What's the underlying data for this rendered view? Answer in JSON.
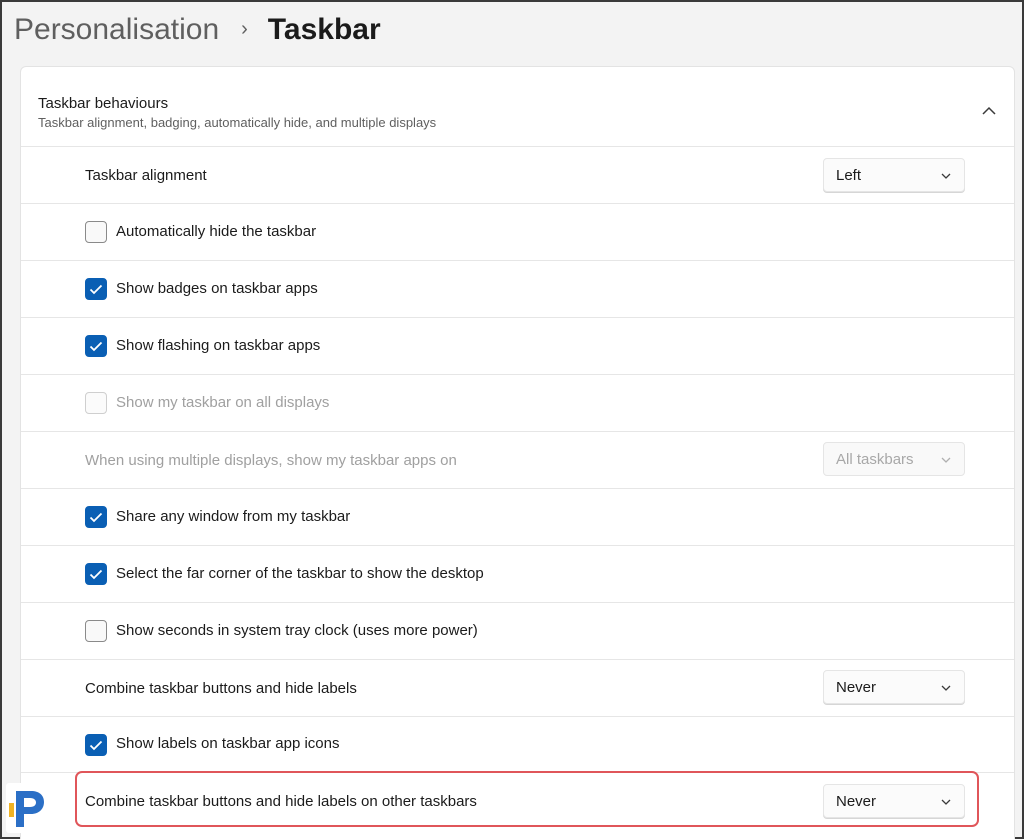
{
  "breadcrumb": {
    "parent": "Personalisation",
    "separator": "›",
    "current": "Taskbar"
  },
  "section": {
    "title": "Taskbar behaviours",
    "subtitle": "Taskbar alignment, badging, automatically hide, and multiple displays",
    "collapse_icon": "chevron-up-icon"
  },
  "settings": {
    "alignment": {
      "label": "Taskbar alignment",
      "value": "Left"
    },
    "auto_hide": {
      "label": "Automatically hide the taskbar",
      "checked": false
    },
    "badges": {
      "label": "Show badges on taskbar apps",
      "checked": true
    },
    "flashing": {
      "label": "Show flashing on taskbar apps",
      "checked": true
    },
    "all_displays": {
      "label": "Show my taskbar on all displays",
      "checked": false,
      "disabled": true
    },
    "multi_display_apps": {
      "label": "When using multiple displays, show my taskbar apps on",
      "value": "All taskbars",
      "disabled": true
    },
    "share_window": {
      "label": "Share any window from my taskbar",
      "checked": true
    },
    "far_corner": {
      "label": "Select the far corner of the taskbar to show the desktop",
      "checked": true
    },
    "seconds_clock": {
      "label": "Show seconds in system tray clock (uses more power)",
      "checked": false
    },
    "combine_buttons": {
      "label": "Combine taskbar buttons and hide labels",
      "value": "Never"
    },
    "show_labels": {
      "label": "Show labels on taskbar app icons",
      "checked": true
    },
    "combine_other": {
      "label": "Combine taskbar buttons and hide labels on other taskbars",
      "value": "Never",
      "highlighted": true
    }
  },
  "colors": {
    "accent": "#0a5fb4",
    "highlight_border": "#e0565a",
    "logo_blue": "#2b6fc6"
  }
}
